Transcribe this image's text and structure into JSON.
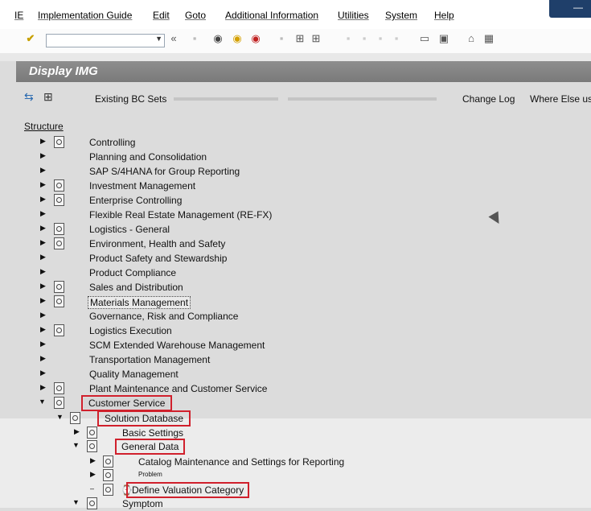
{
  "menu": {
    "items": [
      "IE",
      "Implementation Guide",
      "Edit",
      "Goto",
      "Additional Information",
      "Utilities",
      "System",
      "Help"
    ]
  },
  "toolbar": {
    "command_value": "",
    "icons": [
      "enter-icon",
      "save-icon",
      "back-icon",
      "exit-icon",
      "cancel-icon",
      "print-icon",
      "find-icon",
      "find-next-icon",
      "first-page-icon",
      "prev-page-icon",
      "next-page-icon",
      "last-page-icon",
      "new-session-icon",
      "shortcut-icon",
      "help-icon",
      "layout-icon"
    ]
  },
  "title": "Display IMG",
  "app_toolbar": {
    "existing_bc_sets": "Existing BC Sets",
    "change_log": "Change Log",
    "where_used": "Where Else us"
  },
  "tree": {
    "header": "Structure",
    "nodes": [
      {
        "label": "Controlling",
        "level": 0,
        "icon": true
      },
      {
        "label": "Planning and Consolidation",
        "level": 0,
        "icon": false
      },
      {
        "label": "SAP S/4HANA for Group Reporting",
        "level": 0,
        "icon": false
      },
      {
        "label": "Investment Management",
        "level": 0,
        "icon": true
      },
      {
        "label": "Enterprise Controlling",
        "level": 0,
        "icon": true
      },
      {
        "label": "Flexible Real Estate Management (RE-FX)",
        "level": 0,
        "icon": false
      },
      {
        "label": "Logistics - General",
        "level": 0,
        "icon": true
      },
      {
        "label": "Environment, Health and Safety",
        "level": 0,
        "icon": true
      },
      {
        "label": "Product Safety and Stewardship",
        "level": 0,
        "icon": false
      },
      {
        "label": "Product Compliance",
        "level": 0,
        "icon": false
      },
      {
        "label": "Sales and Distribution",
        "level": 0,
        "icon": true
      },
      {
        "label": "Materials Management",
        "level": 0,
        "icon": true
      },
      {
        "label": "Governance, Risk and Compliance",
        "level": 0,
        "icon": false
      },
      {
        "label": "Logistics Execution",
        "level": 0,
        "icon": true
      },
      {
        "label": "SCM Extended Warehouse Management",
        "level": 0,
        "icon": false
      },
      {
        "label": "Transportation Management",
        "level": 0,
        "icon": false
      },
      {
        "label": "Quality Management",
        "level": 0,
        "icon": false
      },
      {
        "label": "Plant Maintenance and Customer Service",
        "level": 0,
        "icon": true
      },
      {
        "label": "Customer Service",
        "level": 0,
        "icon": true
      },
      {
        "label": "Solution Database",
        "level": 1,
        "icon": true
      },
      {
        "label": "Basic Settings",
        "level": 2,
        "icon": true
      },
      {
        "label": "General Data",
        "level": 2,
        "icon": true
      },
      {
        "label": "Catalog Maintenance and Settings for Reporting",
        "level": 3,
        "icon": true
      },
      {
        "label": "Problem",
        "level": 3,
        "icon": true
      },
      {
        "label": "Define Valuation Category",
        "level": 3,
        "icon": true
      },
      {
        "label": "Symptom",
        "level": 2,
        "icon": true
      }
    ]
  }
}
